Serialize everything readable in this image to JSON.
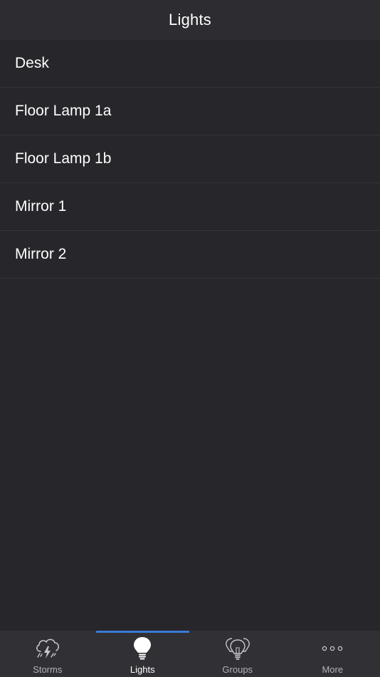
{
  "header": {
    "title": "Lights"
  },
  "lights": [
    {
      "label": "Desk"
    },
    {
      "label": "Floor Lamp 1a"
    },
    {
      "label": "Floor Lamp 1b"
    },
    {
      "label": "Mirror 1"
    },
    {
      "label": "Mirror 2"
    }
  ],
  "tabs": [
    {
      "label": "Storms",
      "icon": "storm-cloud-icon"
    },
    {
      "label": "Lights",
      "icon": "lightbulb-icon",
      "active": true
    },
    {
      "label": "Groups",
      "icon": "bulb-group-icon"
    },
    {
      "label": "More",
      "icon": "more-dots-icon"
    }
  ],
  "colors": {
    "background": "#26262b",
    "nav_bar": "#2c2c31",
    "tab_bar": "#303035",
    "accent": "#3a7bd5",
    "divider": "#34343a"
  }
}
